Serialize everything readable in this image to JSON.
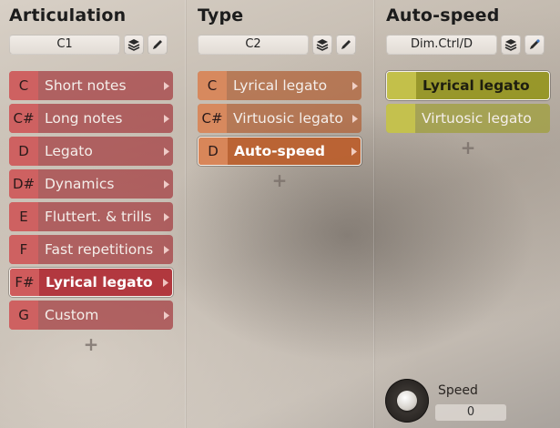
{
  "columns": {
    "articulation": {
      "title": "Articulation",
      "selector_value": "C1",
      "items": [
        {
          "key": "C",
          "label": "Short notes"
        },
        {
          "key": "C#",
          "label": "Long notes"
        },
        {
          "key": "D",
          "label": "Legato"
        },
        {
          "key": "D#",
          "label": "Dynamics"
        },
        {
          "key": "E",
          "label": "Fluttert. & trills"
        },
        {
          "key": "F",
          "label": "Fast repetitions"
        },
        {
          "key": "F#",
          "label": "Lyrical legato"
        },
        {
          "key": "G",
          "label": "Custom"
        }
      ],
      "selected_index": 6,
      "add_label": "+"
    },
    "type": {
      "title": "Type",
      "selector_value": "C2",
      "items": [
        {
          "key": "C",
          "label": "Lyrical legato"
        },
        {
          "key": "C#",
          "label": "Virtuosic legato"
        },
        {
          "key": "D",
          "label": "Auto-speed"
        }
      ],
      "selected_index": 2,
      "add_label": "+"
    },
    "auto_speed": {
      "title": "Auto-speed",
      "selector_value": "Dim.Ctrl/D",
      "items": [
        {
          "key": "",
          "label": "Lyrical legato"
        },
        {
          "key": "",
          "label": "Virtuosic legato"
        }
      ],
      "selected_index": 0,
      "add_label": "+"
    }
  },
  "speed": {
    "label": "Speed",
    "value": "0"
  },
  "icons": {
    "layers": "layers-icon",
    "edit": "pencil-icon",
    "arrow": "triangle-right-icon"
  },
  "colors": {
    "articulation": "#a43a3e",
    "type": "#b05f34",
    "auto_speed": "#a0a037"
  }
}
